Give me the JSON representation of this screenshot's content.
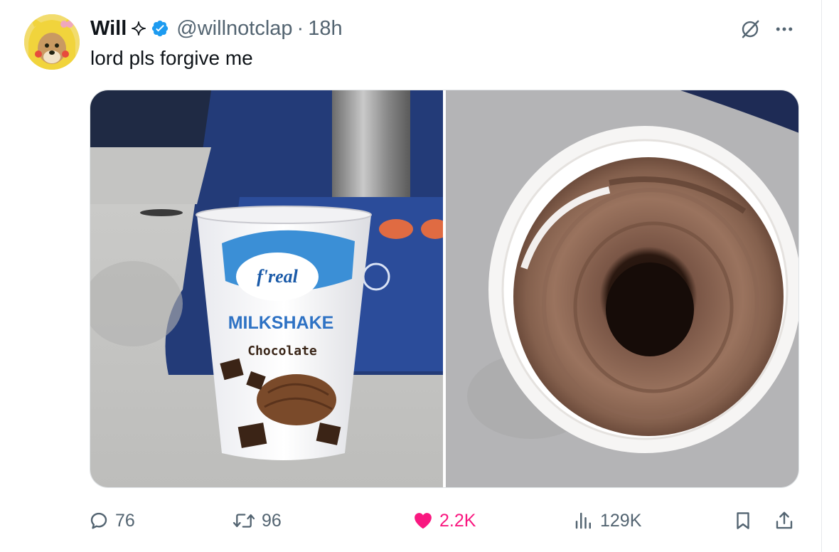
{
  "author": {
    "name": "Will",
    "handle": "@willnotclap",
    "separator": "·",
    "time": "18h",
    "verified": true,
    "avatar_icon": "dog-in-pikachu-hat-avatar"
  },
  "tweet": {
    "text": "lord pls forgive me"
  },
  "media": {
    "images": [
      {
        "name": "milkshake-cup-photo",
        "cup_brand": "f'real",
        "cup_title": "MILKSHAKE",
        "cup_flavor": "Chocolate"
      },
      {
        "name": "cup-top-down-hole-photo"
      }
    ]
  },
  "actions": {
    "replies": "76",
    "reposts": "96",
    "likes": "2.2K",
    "views": "129K",
    "liked": true
  },
  "icons": {
    "grok": "grok-icon",
    "more": "more-icon",
    "reply": "reply-icon",
    "repost": "repost-icon",
    "like": "heart-icon",
    "views": "views-icon",
    "bookmark": "bookmark-icon",
    "share": "share-icon"
  },
  "colors": {
    "like_active": "#f91880",
    "verified": "#1d9bf0",
    "secondary_text": "#536471",
    "primary_text": "#0f1419"
  }
}
